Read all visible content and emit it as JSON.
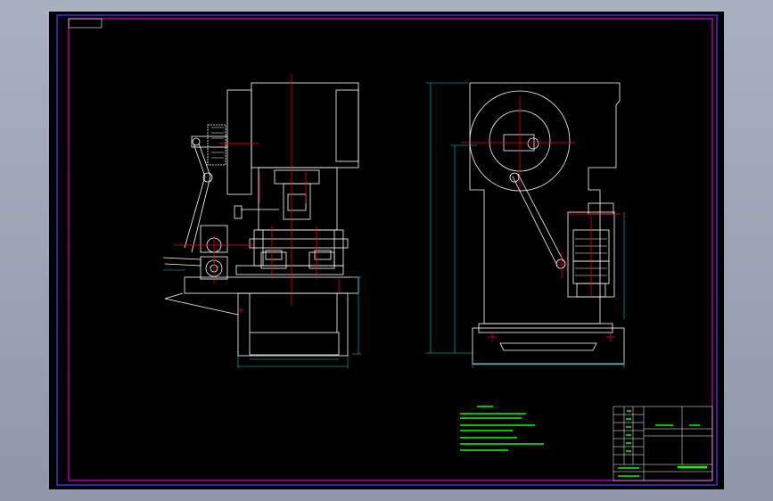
{
  "app": {
    "theme": "cad-dark",
    "background_color": "#000000",
    "frame_color": "#ff00ff",
    "line_color": "#ffffff",
    "center_line_color": "#ff0000",
    "dimension_color": "#00cccc",
    "note_color": "#00ff00"
  },
  "drawing": {
    "views": [
      {
        "name": "side-view"
      },
      {
        "name": "front-view"
      }
    ],
    "technical_requirements": {
      "heading": "",
      "lines": [
        {
          "text": ""
        },
        {
          "text": ""
        },
        {
          "text": ""
        },
        {
          "text": ""
        },
        {
          "text": ""
        },
        {
          "text": ""
        }
      ]
    },
    "title_block": {
      "company": "",
      "drawing_number": "",
      "scale": ""
    }
  }
}
